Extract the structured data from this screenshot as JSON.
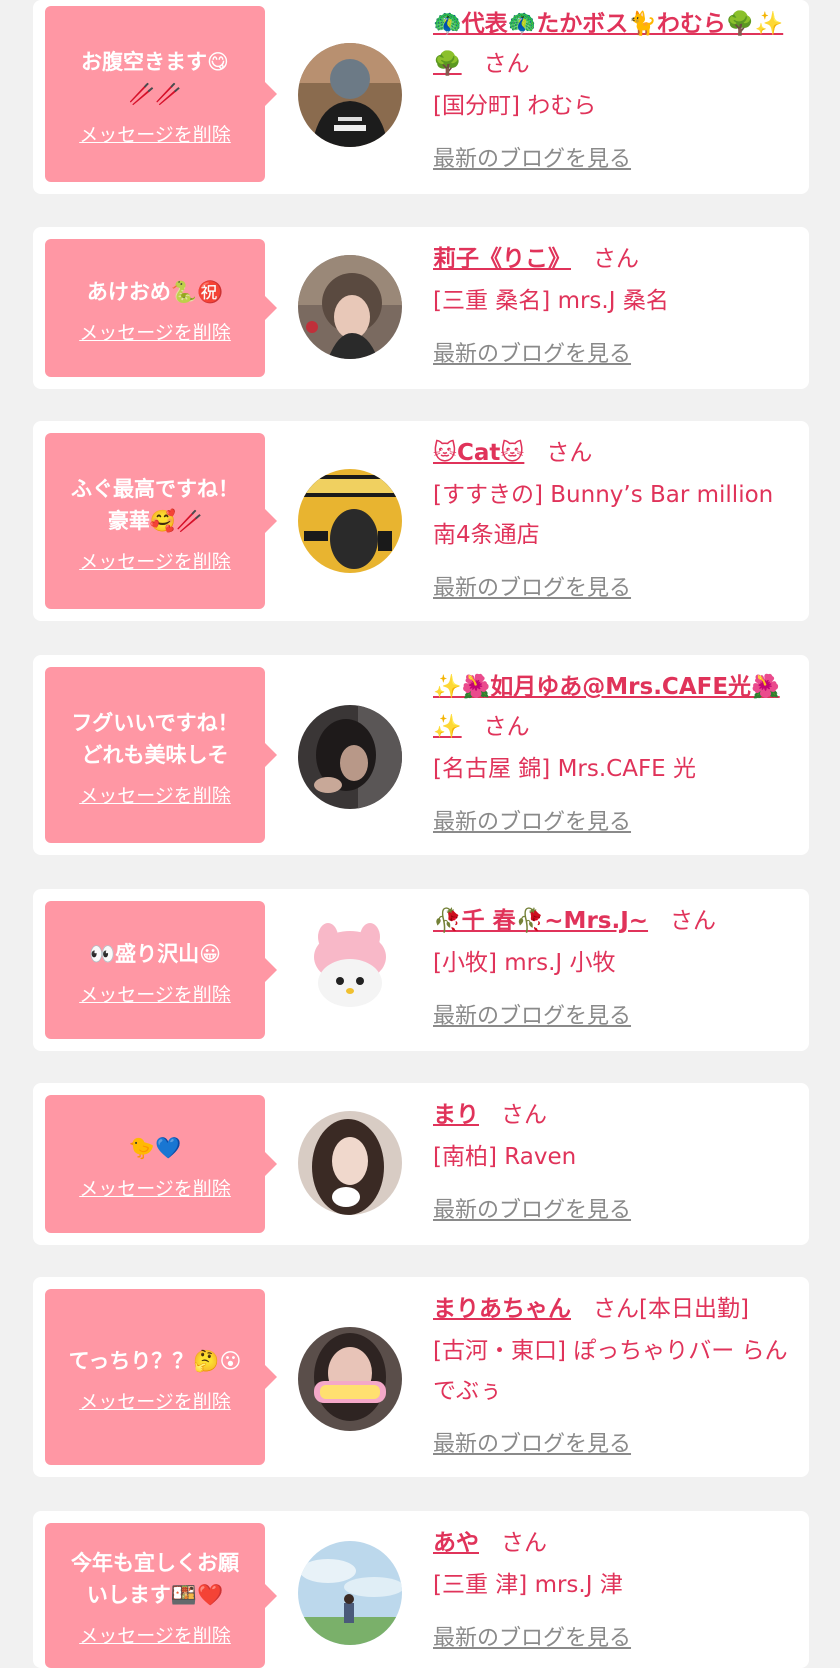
{
  "colors": {
    "background": "#f1f1f1",
    "card": "#ffffff",
    "bubble": "#ff97a4",
    "accent_text": "#e0335a",
    "blog_link": "#8a8a8a"
  },
  "delete_label": "メッセージを削除",
  "blog_label": "最新のブログを見る",
  "san_label": "さん",
  "cards": [
    {
      "message": "お腹空きます😋\n🥢🥢",
      "name": "🦚代表🦚たかボス🐈わむら🌳✨🌳",
      "suffix": "さん",
      "shop": "[国分町] わむら",
      "avatar_icon": "photo-boss-jacket"
    },
    {
      "message": "あけおめ🐍㊗️",
      "name": "莉子《りこ》",
      "suffix": "さん",
      "shop": "[三重 桑名] mrs.J 桑名",
      "avatar_icon": "photo-short-hair"
    },
    {
      "message": "ふぐ最高ですね！\n豪華🥰🥢",
      "name": "🐱Cat🐱",
      "suffix": "さん",
      "shop": "[すすきの] Bunny’s Bar million 南4条通店",
      "avatar_icon": "photo-bunny-magazine"
    },
    {
      "message": "フグいいですね！\nどれも美味しそ",
      "name": "✨🌺如月ゆあ@Mrs.CAFE光🌺✨",
      "suffix": "さん",
      "shop": "[名古屋 錦] Mrs.CAFE 光",
      "avatar_icon": "photo-dark-hair"
    },
    {
      "message": "👀盛り沢山😀",
      "name": "🥀千 春🥀~Mrs.J~",
      "suffix": "さん",
      "shop": "[小牧] mrs.J 小牧",
      "avatar_icon": "photo-pink-plush"
    },
    {
      "message": "🐤💙",
      "name": "まり",
      "suffix": "さん",
      "shop": "[南柏] Raven",
      "avatar_icon": "photo-long-hair"
    },
    {
      "message": "てっちり？？🤔😮",
      "name": "まりあちゃん",
      "suffix": "さん[本日出勤]",
      "shop": "[古河・東口] ぽっちゃりバー らんでぶぅ",
      "avatar_icon": "photo-happy-sticker"
    },
    {
      "message": "今年も宜しくお願\nいします🍱❤️",
      "name": "あや",
      "suffix": "さん",
      "shop": "[三重 津] mrs.J 津",
      "avatar_icon": "photo-sky-field"
    }
  ]
}
